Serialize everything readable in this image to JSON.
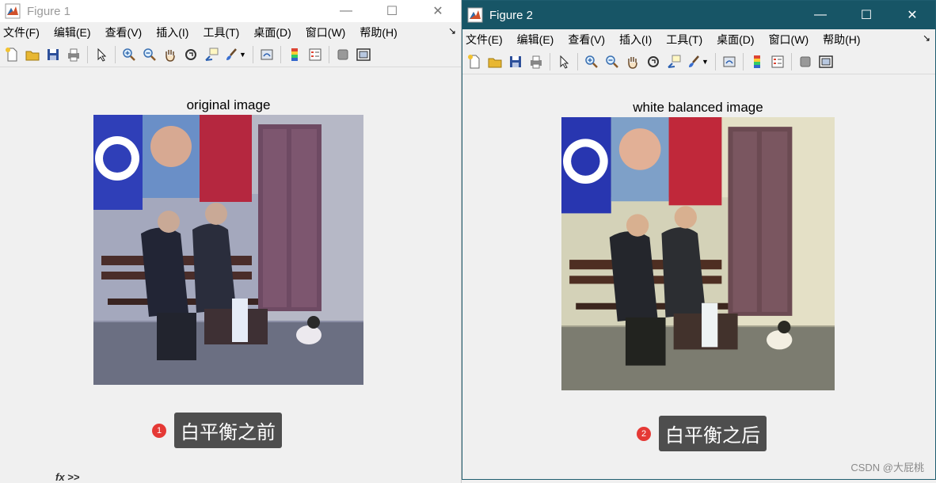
{
  "figure1": {
    "title": "Figure 1",
    "window_controls": {
      "minimize": "—",
      "maximize": "☐",
      "close": "✕"
    },
    "menu": [
      "文件(F)",
      "编辑(E)",
      "查看(V)",
      "插入(I)",
      "工具(T)",
      "桌面(D)",
      "窗口(W)",
      "帮助(H)"
    ],
    "axes_title": "original image",
    "annotation": {
      "number": "1",
      "label": "白平衡之前"
    },
    "command": "fx >>"
  },
  "figure2": {
    "title": "Figure 2",
    "window_controls": {
      "minimize": "—",
      "maximize": "☐",
      "close": "✕"
    },
    "menu": [
      "文件(E)",
      "编辑(E)",
      "查看(V)",
      "插入(I)",
      "工具(T)",
      "桌面(D)",
      "窗口(W)",
      "帮助(H)"
    ],
    "axes_title": "white balanced image",
    "annotation": {
      "number": "2",
      "label": "白平衡之后"
    },
    "watermark": "CSDN @大屁桃"
  },
  "toolbar_icons": [
    "new-figure-icon",
    "open-file-icon",
    "save-icon",
    "print-icon",
    "select-arrow-icon",
    "zoom-in-icon",
    "zoom-out-icon",
    "pan-hand-icon",
    "rotate-3d-icon",
    "data-cursor-icon",
    "brush-icon",
    "link-plot-icon",
    "colorbar-icon",
    "legend-icon",
    "hide-plot-tools-icon",
    "show-plot-tools-icon"
  ],
  "colors": {
    "fig2_titlebar": "#175566",
    "badge": "#e53935",
    "label_bg": "#4e4e4e"
  }
}
